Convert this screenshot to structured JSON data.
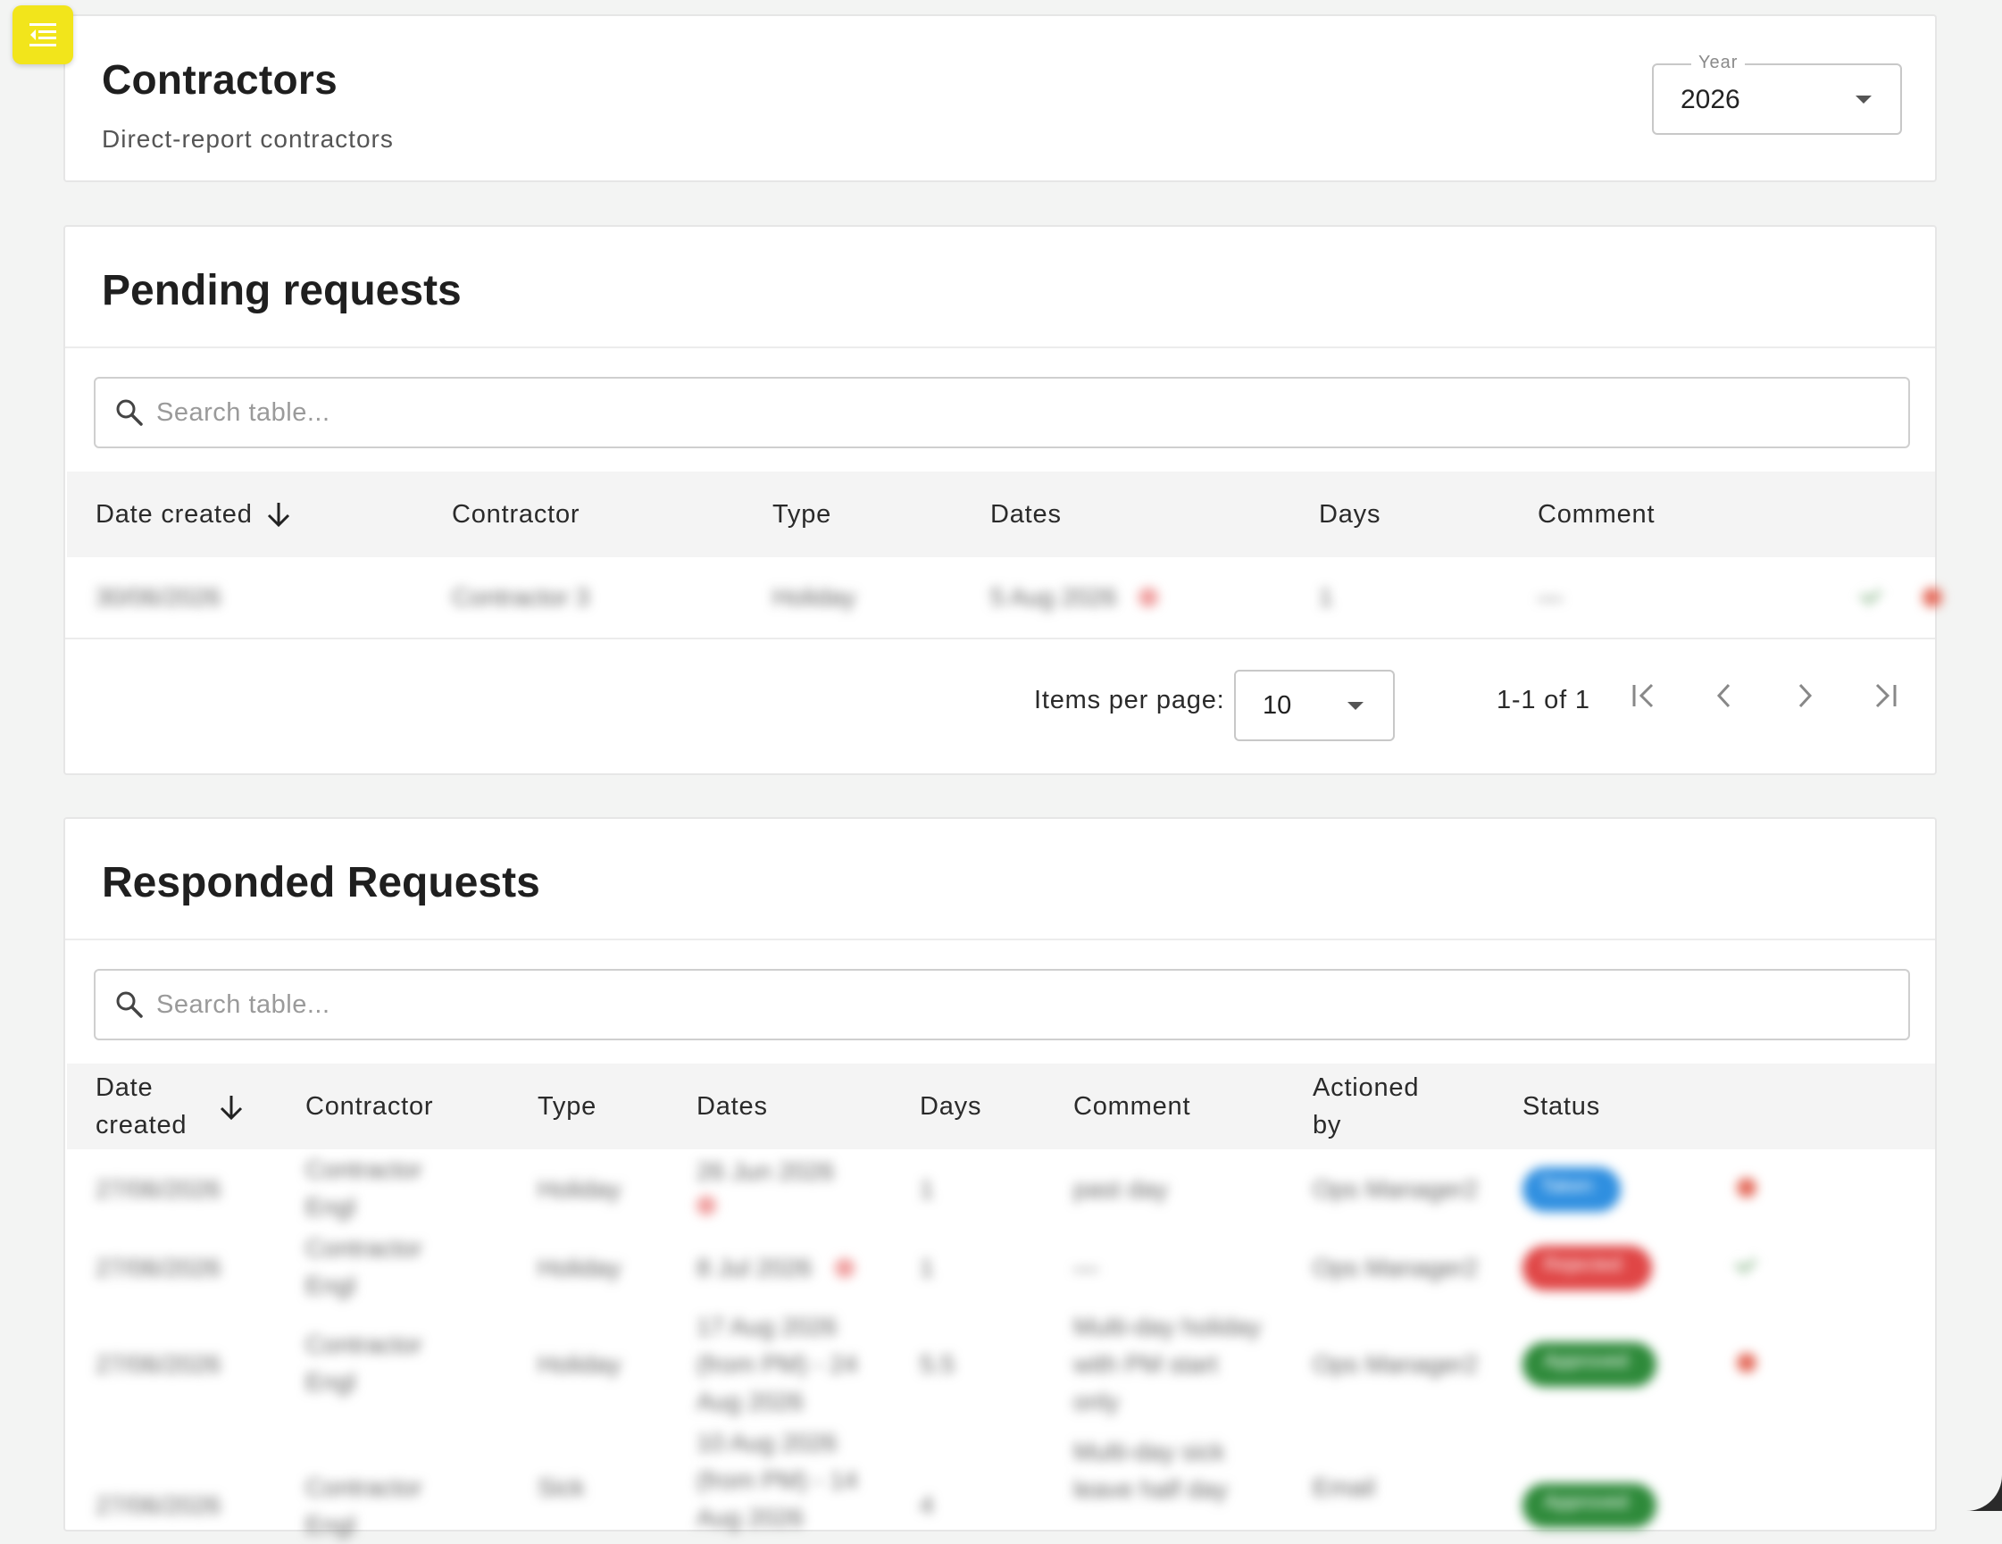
{
  "header": {
    "title": "Contractors",
    "subtitle": "Direct-report contractors",
    "year_label": "Year",
    "year_value": "2026"
  },
  "pending": {
    "title": "Pending requests",
    "search_placeholder": "Search table...",
    "columns": [
      "Date created",
      "Contractor",
      "Type",
      "Dates",
      "Days",
      "Comment"
    ],
    "rows": [
      {
        "date_created": "30/06/2026",
        "contractor": "Contractor 3",
        "type": "Holiday",
        "dates": "5 Aug 2026",
        "days": "1",
        "comment": "—"
      }
    ],
    "pager": {
      "items_per_page_label": "Items per page:",
      "items_per_page_value": "10",
      "range": "1-1 of 1"
    }
  },
  "responded": {
    "title": "Responded Requests",
    "search_placeholder": "Search table...",
    "columns": [
      "Date created",
      "Contractor",
      "Type",
      "Dates",
      "Days",
      "Comment",
      "Actioned by",
      "Status"
    ],
    "rows": [
      {
        "date_created": "27/06/2026",
        "contractor": "Contractor Engl",
        "type": "Holiday",
        "dates": "26 Jun 2026",
        "days": "1",
        "comment": "past day",
        "actioned_by": "Ops Manager2",
        "status": "Taken",
        "status_color": "#2f8fe0"
      },
      {
        "date_created": "27/06/2026",
        "contractor": "Contractor Engl",
        "type": "Holiday",
        "dates": "8 Jul 2026",
        "days": "1",
        "comment": "—",
        "actioned_by": "Ops Manager2",
        "status": "Rejected",
        "status_color": "#e04646"
      },
      {
        "date_created": "27/06/2026",
        "contractor": "Contractor Engl",
        "type": "Holiday",
        "dates": "17 Aug 2026 (from PM) - 24 Aug 2026",
        "days": "5.5",
        "comment": "Multi-day holiday with PM start only",
        "actioned_by": "Ops Manager2",
        "status": "Approved",
        "status_color": "#2e8a3a"
      },
      {
        "date_created": "27/06/2026",
        "contractor": "Contractor Engl",
        "type": "Sick",
        "dates": "10 Aug 2026 (from PM) - 14 Aug 2026",
        "days": "4",
        "comment": "Multi-day sick leave half day",
        "actioned_by": "Email",
        "status": "Approved",
        "status_color": "#2e8a3a"
      }
    ]
  },
  "colors": {
    "accent": "#f2e51b",
    "approve": "#7fb07f",
    "cancel": "#e46a5a"
  },
  "icons": {
    "menu": "menu-collapse-icon",
    "search": "search-icon",
    "sort": "arrow-down-icon",
    "first": "first-page-icon",
    "prev": "chevron-left-icon",
    "next": "chevron-right-icon",
    "last": "last-page-icon"
  }
}
